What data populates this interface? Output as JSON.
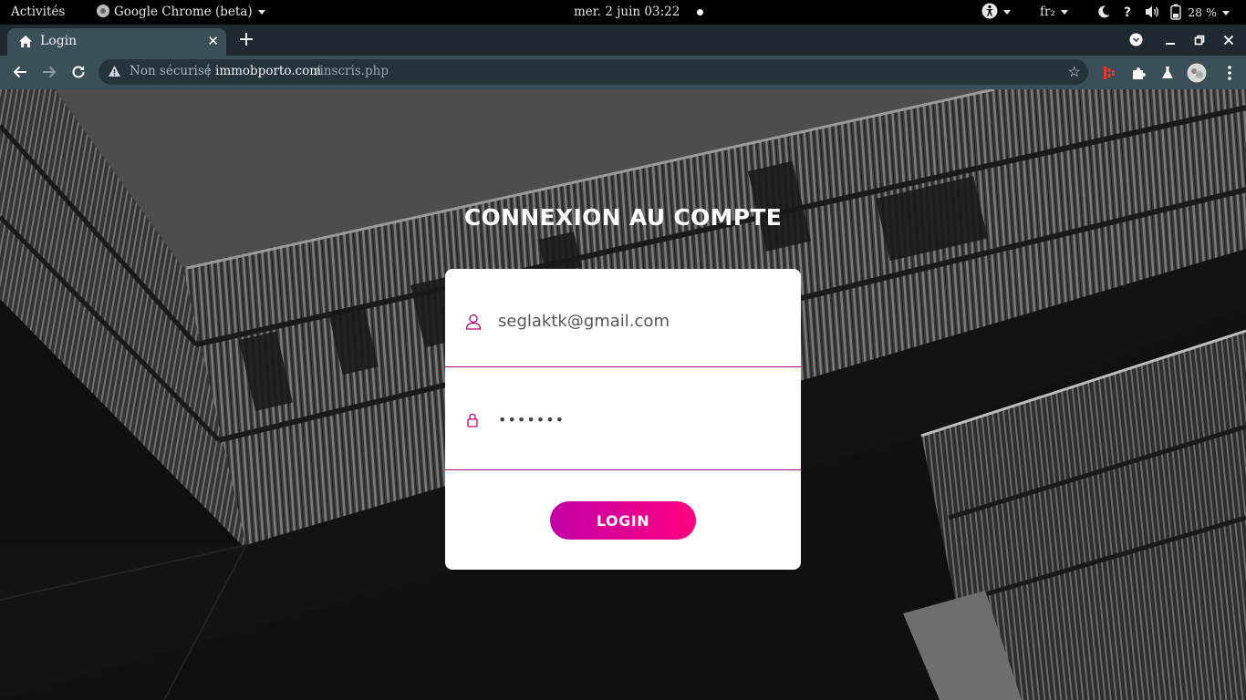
{
  "system_bar": {
    "activities": "Activités",
    "app_name": "Google Chrome (beta)",
    "datetime": "mer. 2 juin  03:22",
    "keyboard_layout": "fr₂",
    "battery": "28 %"
  },
  "browser": {
    "tab_title": "Login",
    "security_label": "Non sécurisé",
    "url_host": "immobporto.com",
    "url_path": "/inscris.php"
  },
  "page": {
    "heading": "CONNEXION AU COMPTE",
    "email_value": "seglaktk@gmail.com",
    "password_value": "•••••••",
    "login_label": "LOGIN",
    "accent_color": "#ff0080",
    "icons": [
      "user-icon",
      "lock-icon"
    ]
  }
}
